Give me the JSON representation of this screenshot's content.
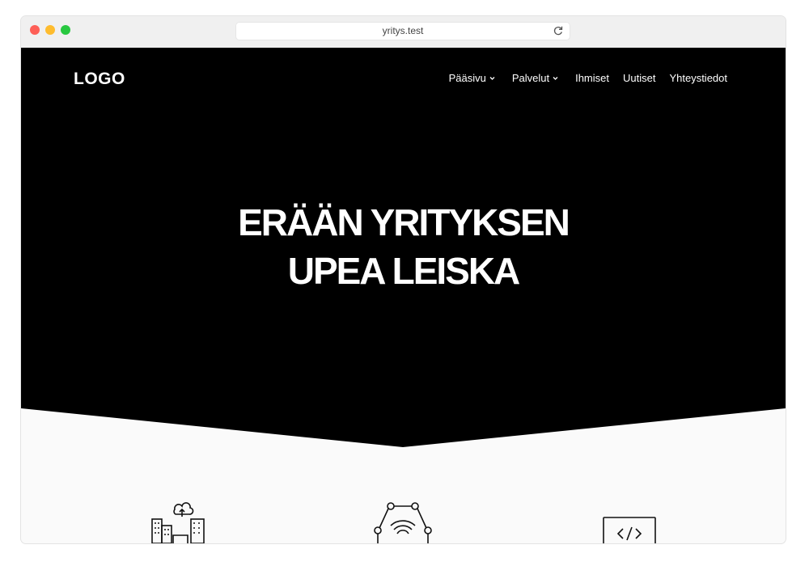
{
  "browser": {
    "url": "yritys.test"
  },
  "site": {
    "logo": "LOGO",
    "nav": [
      {
        "label": "Pääsivu",
        "has_dropdown": true
      },
      {
        "label": "Palvelut",
        "has_dropdown": true
      },
      {
        "label": "Ihmiset",
        "has_dropdown": false
      },
      {
        "label": "Uutiset",
        "has_dropdown": false
      },
      {
        "label": "Yhteystiedot",
        "has_dropdown": false
      }
    ],
    "hero": {
      "line1": "ERÄÄN YRITYKSEN",
      "line2": "UPEA LEISKA",
      "bg_color": "#000000"
    },
    "features": {
      "icons": [
        "city-cloud-icon",
        "network-wifi-icon",
        "code-window-icon"
      ]
    }
  },
  "colors": {
    "hero_bg": "#000000",
    "page_bg": "#fafafa",
    "text_light": "#ffffff"
  }
}
